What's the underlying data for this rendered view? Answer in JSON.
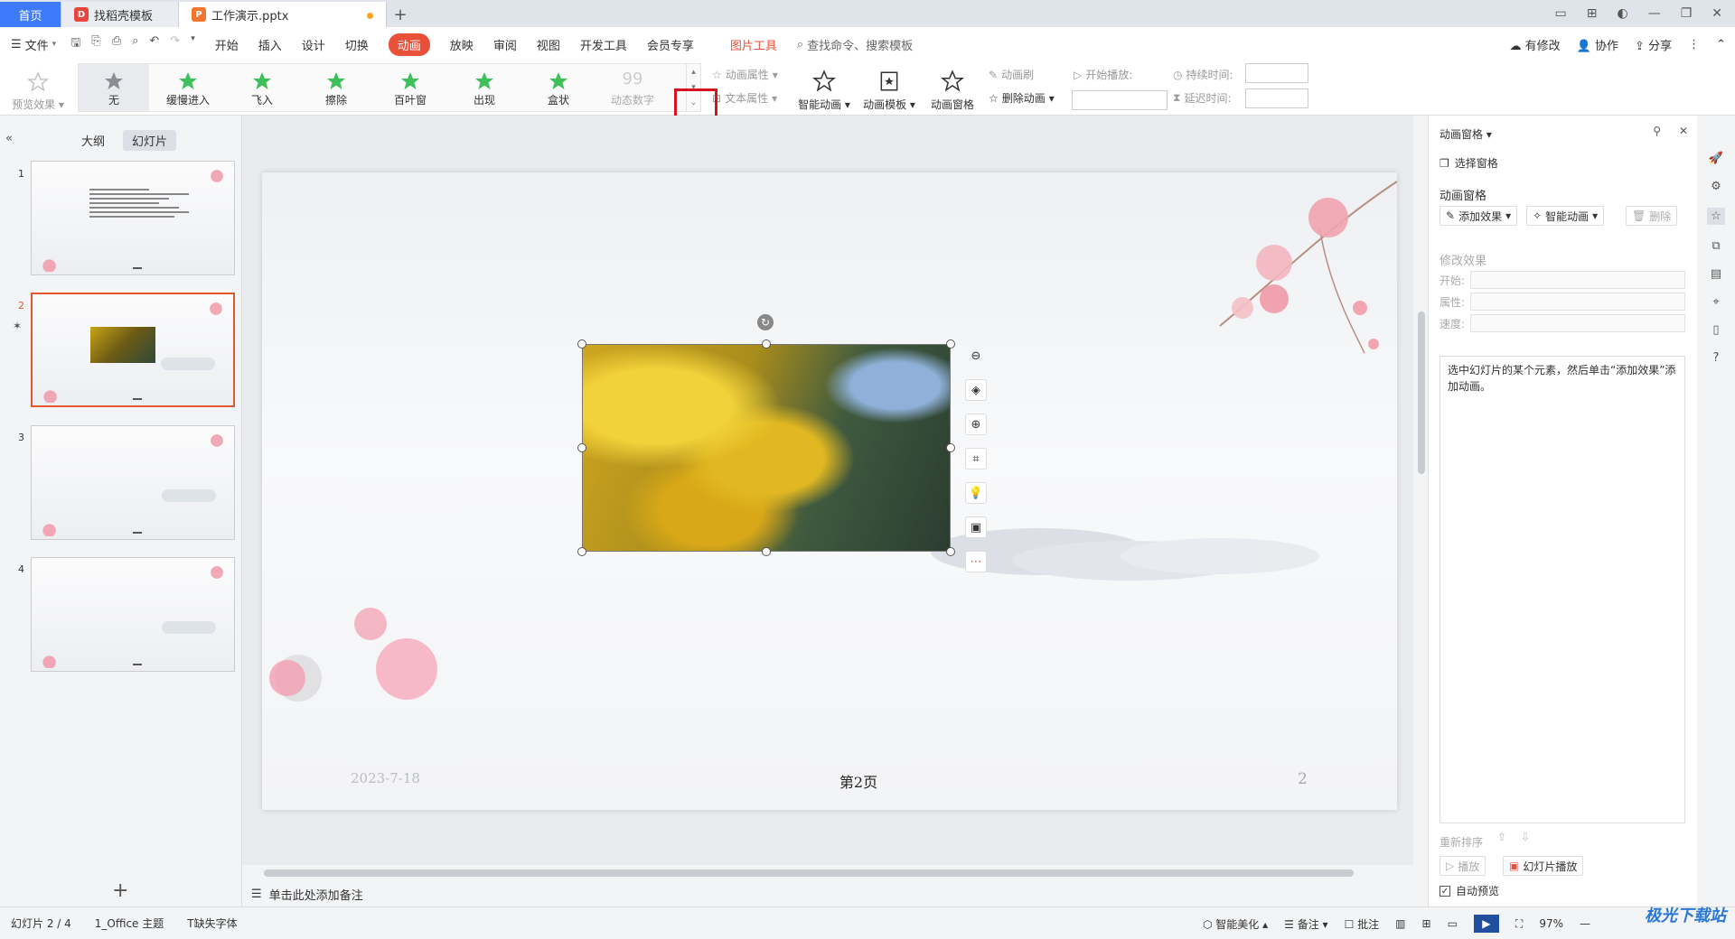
{
  "tabs": {
    "home": "首页",
    "template": "找稻壳模板",
    "document": "工作演示.pptx"
  },
  "menu": {
    "file": "文件",
    "items": [
      "开始",
      "插入",
      "设计",
      "切换",
      "动画",
      "放映",
      "审阅",
      "视图",
      "开发工具",
      "会员专享"
    ],
    "picture_tools": "图片工具",
    "search": "查找命令、搜索模板",
    "modify": "有修改",
    "collab": "协作",
    "share": "分享"
  },
  "ribbon": {
    "preview": "预览效果",
    "gallery": [
      "无",
      "缓慢进入",
      "飞入",
      "擦除",
      "百叶窗",
      "出现",
      "盒状",
      "动态数字"
    ],
    "anim_props": "动画属性",
    "text_props": "文本属性",
    "smart_anim": "智能动画",
    "anim_template": "动画模板",
    "anim_pane": "动画窗格",
    "anim_brush": "动画刷",
    "delete_anim": "删除动画",
    "start_play": "开始播放:",
    "duration": "持续时间:",
    "delay": "延迟时间:"
  },
  "left_panel": {
    "outline": "大纲",
    "slides": "幻灯片",
    "numbers": [
      "1",
      "2",
      "3",
      "4"
    ]
  },
  "slide": {
    "date": "2023-7-18",
    "page_label": "第2页",
    "page_num": "2"
  },
  "notes": "单击此处添加备注",
  "right_panel": {
    "title": "动画窗格",
    "select_pane": "选择窗格",
    "section": "动画窗格",
    "add_effect": "添加效果",
    "smart_anim": "智能动画",
    "delete": "删除",
    "modify_effect": "修改效果",
    "start": "开始:",
    "property": "属性:",
    "speed": "速度:",
    "hint": "选中幻灯片的某个元素，然后单击“添加效果”添加动画。",
    "reorder": "重新排序",
    "play": "播放",
    "slideshow": "幻灯片播放",
    "auto_preview": "自动预览"
  },
  "status": {
    "slide": "幻灯片 2 / 4",
    "theme": "1_Office 主题",
    "font": "缺失字体",
    "beautify": "智能美化",
    "notes": "备注",
    "comment": "批注",
    "zoom": "97%"
  },
  "watermark": "极光下载站",
  "colors": {
    "accent": "#e8503a",
    "home_tab": "#3e7bfa",
    "highlight_box": "#d4151d",
    "star": "#3dbf5a"
  }
}
